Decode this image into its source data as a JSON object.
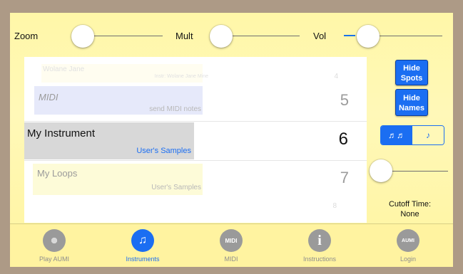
{
  "sliders": {
    "zoom_label": "Zoom",
    "mult_label": "Mult",
    "vol_label": "Vol"
  },
  "instruments": {
    "top_ghost": {
      "name": "Wolane Jane",
      "sub": "Instr: Wolane Jane Mine",
      "num": "4"
    },
    "rows": [
      {
        "name": "MIDI",
        "sub": "send MIDI notes",
        "num": "5"
      },
      {
        "name": "My Instrument",
        "sub": "User's Samples",
        "num": "6"
      },
      {
        "name": "My Loops",
        "sub": "User's Samples",
        "num": "7"
      }
    ],
    "bottom_ghost_num": "8"
  },
  "right_panel": {
    "hide_spots_line1": "Hide",
    "hide_spots_line2": "Spots",
    "hide_names_line1": "Hide",
    "hide_names_line2": "Names",
    "seg_multi": "♬♬",
    "seg_single": "♪",
    "cutoff_label": "Cutoff Time:",
    "cutoff_value": "None"
  },
  "tabs": [
    {
      "label": "Play AUMI",
      "icon": "aumi-icon",
      "glyph": ""
    },
    {
      "label": "Instruments",
      "icon": "music-note-icon",
      "glyph": "♫"
    },
    {
      "label": "MIDI",
      "icon": "midi-icon",
      "glyph": "MIDI"
    },
    {
      "label": "Instructions",
      "icon": "info-icon",
      "glyph": "i"
    },
    {
      "label": "Login",
      "icon": "login-icon",
      "glyph": "AUMI"
    }
  ],
  "colors": {
    "accent_blue": "#1b6ef2",
    "background_yellow": "#fff8b8",
    "frame": "#ad9a86"
  }
}
